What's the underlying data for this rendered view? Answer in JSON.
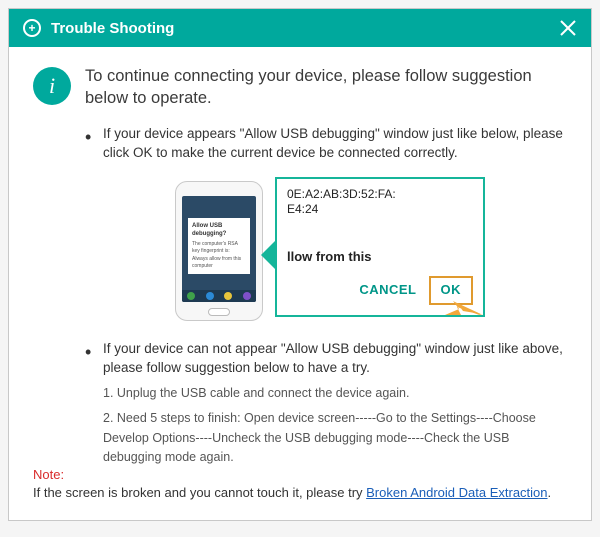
{
  "title": "Trouble Shooting",
  "icons": {
    "shield": "+",
    "info": "i"
  },
  "main_message": "To continue connecting your device, please follow suggestion below to operate.",
  "bullet1": "If your device appears \"Allow USB debugging\" window just like below, please click OK to make the current device  be connected correctly.",
  "bullet2": "If your device can not appear \"Allow USB debugging\" window just like above, please follow suggestion below to have a try.",
  "step1": "1. Unplug the USB cable and connect the device again.",
  "step2": "2. Need 5 steps to finish: Open device screen-----Go to the Settings----Choose Develop Options----Uncheck the USB debugging mode----Check the USB debugging mode again.",
  "phone_popup": {
    "title": "Allow USB debugging?",
    "body": "The computer's RSA key fingerprint is:",
    "chk": "Always allow from this computer"
  },
  "zoom": {
    "mac_line1": "0E:A2:AB:3D:52:FA:",
    "mac_line2": "E4:24",
    "allow": "llow from this",
    "cancel": "CANCEL",
    "ok": "OK"
  },
  "note": {
    "label": "Note:",
    "text": "If the screen is broken and you cannot touch it, please try ",
    "link": "Broken Android Data Extraction",
    "tail": "."
  }
}
